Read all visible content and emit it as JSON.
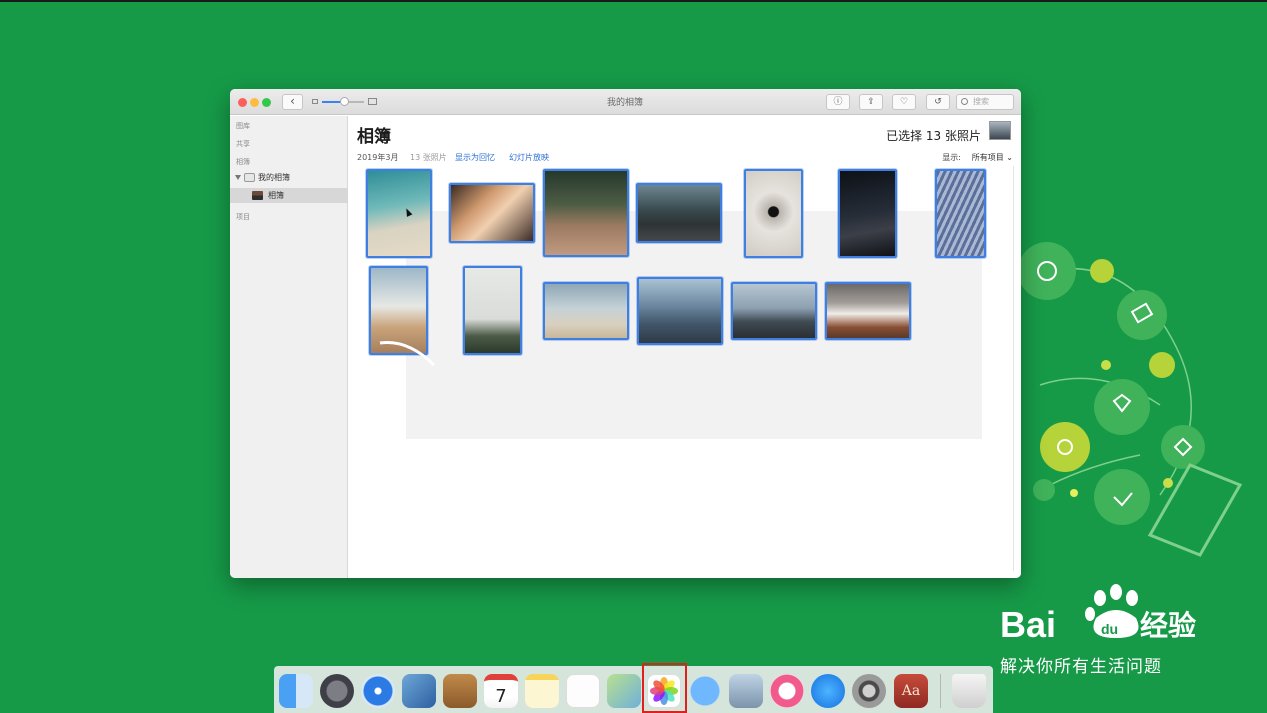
{
  "window": {
    "title": "我的相簿",
    "search_placeholder": "搜索",
    "toolbar": {
      "back_symbol": "‹",
      "info_symbol": "ⓘ",
      "share_symbol": "⇪",
      "favorite_symbol": "♡",
      "rotate_symbol": "↺"
    }
  },
  "sidebar": {
    "sections": [
      {
        "label": "图库"
      },
      {
        "label": "共享"
      },
      {
        "label": "相簿"
      },
      {
        "label": "项目"
      }
    ],
    "folder": "我的相簿",
    "album": "相簿"
  },
  "main": {
    "title": "相簿",
    "date": "2019年3月",
    "count": "13 张照片",
    "show_as_memory": "显示为回忆",
    "slideshow": "幻灯片放映",
    "selected_text": "已选择 13 张照片",
    "show_label": "显示:",
    "show_value": "所有项目",
    "show_chevron": "⌄"
  },
  "photos": [
    {
      "name": "beach-aerial"
    },
    {
      "name": "desert-dunes"
    },
    {
      "name": "pebbles"
    },
    {
      "name": "mountain-road"
    },
    {
      "name": "white-fabric"
    },
    {
      "name": "night-sky"
    },
    {
      "name": "sand-ripples"
    },
    {
      "name": "beach-sky"
    },
    {
      "name": "building-facade"
    },
    {
      "name": "sea-shore"
    },
    {
      "name": "lighthouse"
    },
    {
      "name": "pier-sunset"
    },
    {
      "name": "rocky-coast"
    }
  ],
  "watermark": {
    "logo_text_bai": "Bai",
    "logo_text_du": "du",
    "logo_text_jingyan": "经验",
    "slogan": "解决你所有生活问题"
  },
  "dock": {
    "apps": [
      {
        "name": "finder"
      },
      {
        "name": "launchpad"
      },
      {
        "name": "safari"
      },
      {
        "name": "mail"
      },
      {
        "name": "contacts"
      },
      {
        "name": "calendar",
        "label": "7"
      },
      {
        "name": "notes"
      },
      {
        "name": "reminders"
      },
      {
        "name": "maps"
      },
      {
        "name": "photos"
      },
      {
        "name": "messages"
      },
      {
        "name": "preview"
      },
      {
        "name": "itunes"
      },
      {
        "name": "app-store"
      },
      {
        "name": "system-preferences"
      },
      {
        "name": "dictionary",
        "label": "Aa"
      },
      {
        "name": "trash"
      }
    ],
    "highlighted": "photos"
  },
  "colors": {
    "desktop": "#169a48",
    "selection": "#3f7fe0",
    "link": "#2a6fd6",
    "highlight_box": "#e0201b"
  }
}
